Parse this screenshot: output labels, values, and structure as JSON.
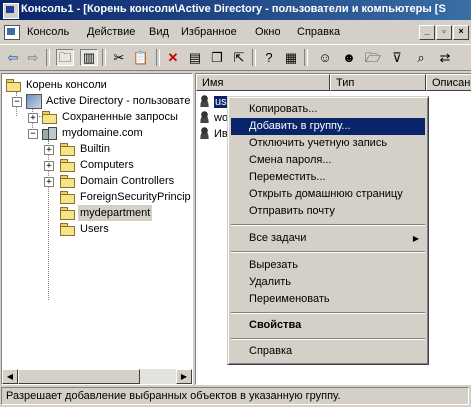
{
  "window": {
    "title": "Консоль1 - [Корень консоли\\Active Directory - пользователи и компьютеры [S"
  },
  "menubar": {
    "items": [
      "Консоль",
      "Действие",
      "Вид",
      "Избранное",
      "Окно",
      "Справка"
    ]
  },
  "toolbar": {
    "icons": [
      "back-arrow-icon",
      "forward-arrow-icon",
      "up-folder-icon",
      "show-tree-icon",
      "cut-icon",
      "paste-icon",
      "delete-icon",
      "properties-icon",
      "copy-icon",
      "export-icon",
      "help-icon",
      "new-user-icon",
      "new-group-icon",
      "new-ou-icon",
      "filter-icon",
      "find-icon"
    ]
  },
  "tree": {
    "root": "Корень консоли",
    "ad": "Active Directory - пользовате",
    "saved": "Сохраненные запросы",
    "domain": "mydomaine.com",
    "children": [
      "Builtin",
      "Computers",
      "Domain Controllers",
      "ForeignSecurityPrincip",
      "mydepartment",
      "Users"
    ],
    "selected": "mydepartment"
  },
  "list": {
    "columns": [
      "Имя",
      "Тип",
      "Описан"
    ],
    "rows": [
      {
        "name": "us",
        "selected": true
      },
      {
        "name": "wo",
        "selected": false
      },
      {
        "name": "Ив",
        "selected": false
      }
    ]
  },
  "context_menu": {
    "group1": [
      "Копировать...",
      "Добавить в группу...",
      "Отключить учетную запись",
      "Смена пароля...",
      "Переместить...",
      "Открыть домашнюю страницу",
      "Отправить почту"
    ],
    "highlighted": "Добавить в группу...",
    "all_tasks": "Все задачи",
    "group2": [
      "Вырезать",
      "Удалить",
      "Переименовать"
    ],
    "properties": "Свойства",
    "help": "Справка"
  },
  "statusbar": {
    "text": "Разрешает добавление выбранных объектов в указанную группу."
  }
}
